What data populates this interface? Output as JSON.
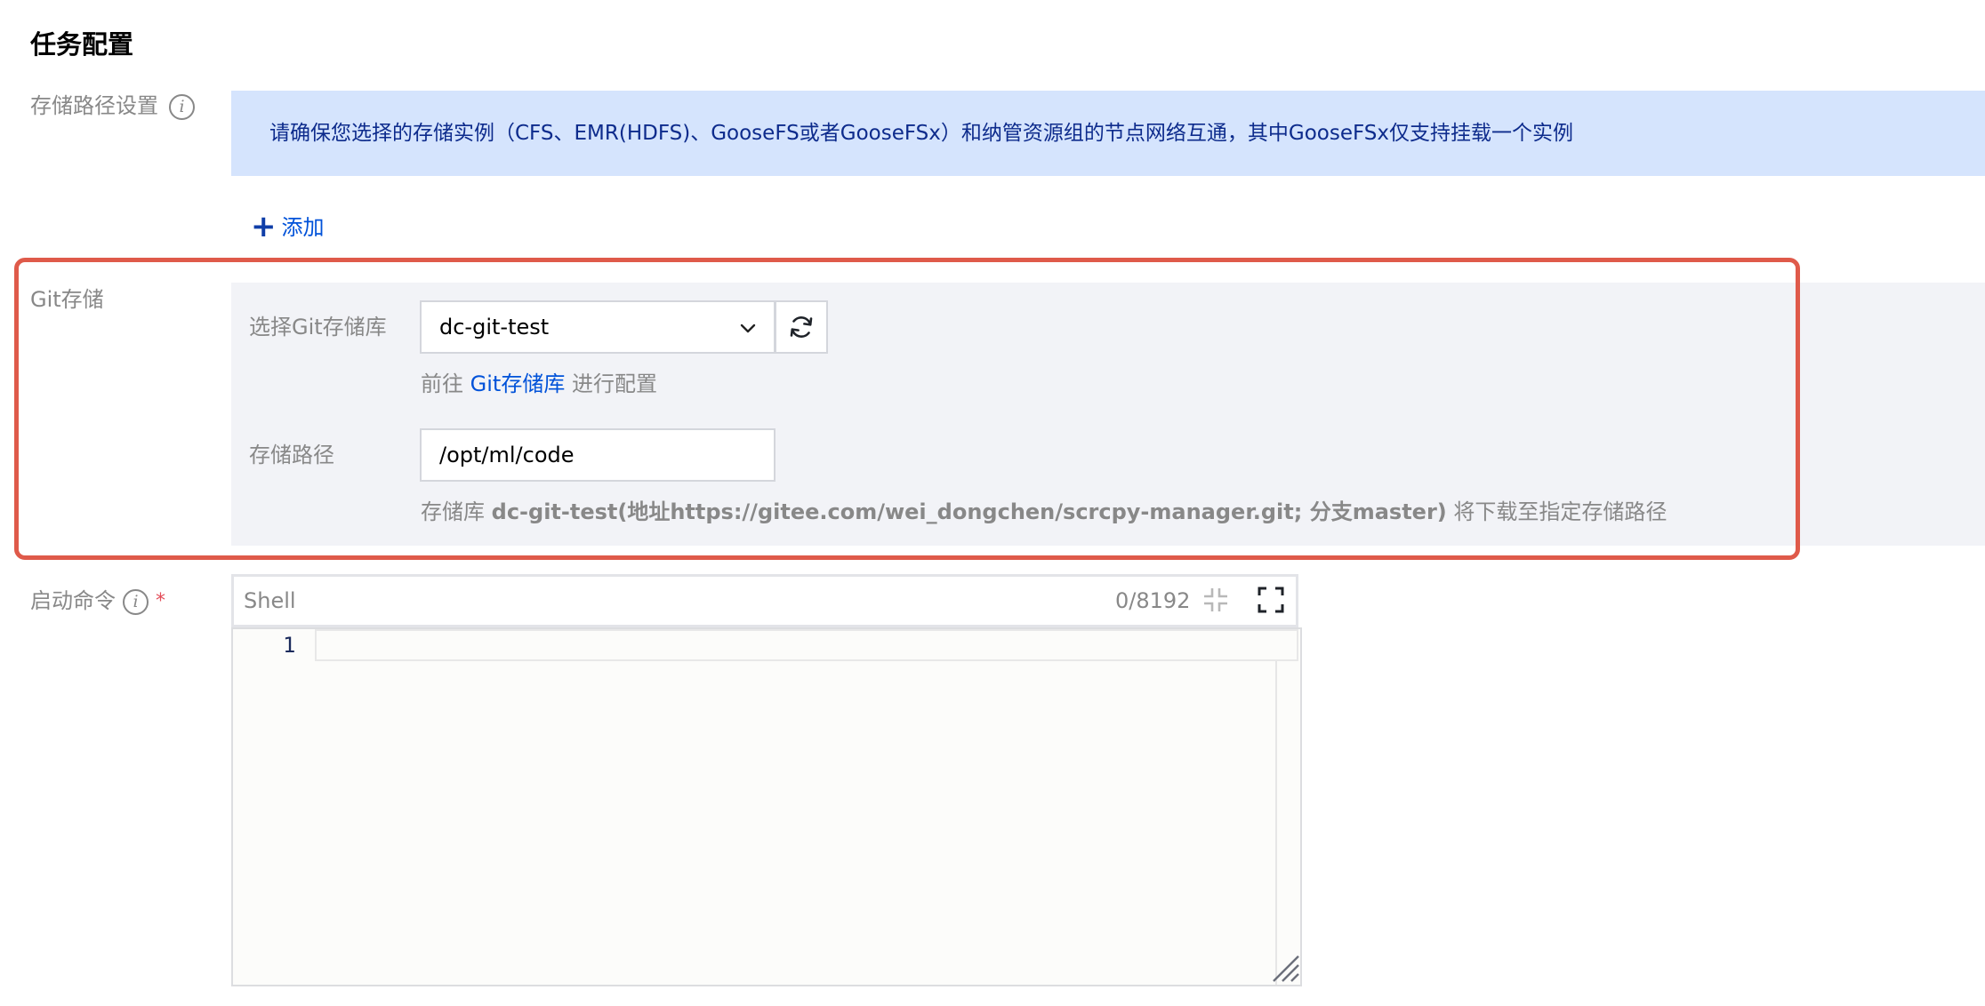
{
  "section": {
    "title": "任务配置"
  },
  "storage_path": {
    "label": "存储路径设置",
    "alert_text": "请确保您选择的存储实例（CFS、EMR(HDFS)、GooseFS或者GooseFSx）和纳管资源组的节点网络互通，其中GooseFSx仅支持挂载一个实例",
    "add_plus": "+",
    "add_label": "添加"
  },
  "git_storage": {
    "label": "Git存储",
    "select_label": "选择Git存储库",
    "selected_repo": "dc-git-test",
    "hint_prefix": "前往",
    "hint_link": "Git存储库",
    "hint_suffix": "进行配置",
    "path_label": "存储路径",
    "path_value": "/opt/ml/code",
    "desc_prefix": "存储库",
    "desc_bold": "dc-git-test(地址https://gitee.com/wei_dongchen/scrcpy-manager.git; 分支master)",
    "desc_suffix": "将下载至指定存储路径"
  },
  "start_command": {
    "label": "启动命令",
    "required_mark": "*",
    "language": "Shell",
    "char_count": "0/8192",
    "line_number": "1"
  },
  "colors": {
    "highlight_border": "#df5a4a",
    "alert_bg": "#d5e4fd",
    "alert_text": "#0d2b8c",
    "link": "#0052d9",
    "panel_bg": "#f2f3f7",
    "required": "#e34d59"
  },
  "icons": {
    "info": "info-circle-icon",
    "add": "plus-icon",
    "dropdown": "chevron-down-icon",
    "refresh": "refresh-icon",
    "collapse": "collapse-icon",
    "fullscreen": "fullscreen-icon",
    "resize": "resize-handle-icon"
  }
}
